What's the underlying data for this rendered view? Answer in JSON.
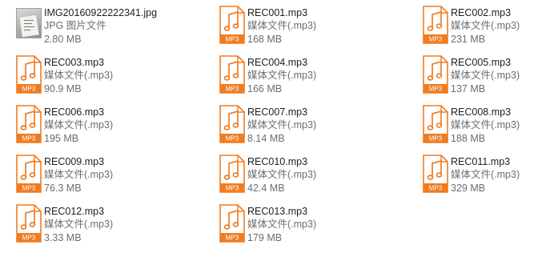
{
  "colors": {
    "mp3_accent": "#f07c22",
    "text_primary": "#1e1e1e",
    "text_secondary": "#6d6d6d"
  },
  "files": [
    {
      "name": "IMG20160922222341.jpg",
      "type": "JPG 图片文件",
      "size": "2.80 MB",
      "icon": "image-thumbnail"
    },
    {
      "name": "REC001.mp3",
      "type": "媒体文件(.mp3)",
      "size": "168 MB",
      "icon": "mp3-file-icon",
      "badge": "MP3"
    },
    {
      "name": "REC002.mp3",
      "type": "媒体文件(.mp3)",
      "size": "231 MB",
      "icon": "mp3-file-icon",
      "badge": "MP3"
    },
    {
      "name": "REC003.mp3",
      "type": "媒体文件(.mp3)",
      "size": "90.9 MB",
      "icon": "mp3-file-icon",
      "badge": "MP3"
    },
    {
      "name": "REC004.mp3",
      "type": "媒体文件(.mp3)",
      "size": "166 MB",
      "icon": "mp3-file-icon",
      "badge": "MP3"
    },
    {
      "name": "REC005.mp3",
      "type": "媒体文件(.mp3)",
      "size": "137 MB",
      "icon": "mp3-file-icon",
      "badge": "MP3"
    },
    {
      "name": "REC006.mp3",
      "type": "媒体文件(.mp3)",
      "size": "195 MB",
      "icon": "mp3-file-icon",
      "badge": "MP3"
    },
    {
      "name": "REC007.mp3",
      "type": "媒体文件(.mp3)",
      "size": "8.14 MB",
      "icon": "mp3-file-icon",
      "badge": "MP3"
    },
    {
      "name": "REC008.mp3",
      "type": "媒体文件(.mp3)",
      "size": "188 MB",
      "icon": "mp3-file-icon",
      "badge": "MP3"
    },
    {
      "name": "REC009.mp3",
      "type": "媒体文件(.mp3)",
      "size": "76.3 MB",
      "icon": "mp3-file-icon",
      "badge": "MP3"
    },
    {
      "name": "REC010.mp3",
      "type": "媒体文件(.mp3)",
      "size": "42.4 MB",
      "icon": "mp3-file-icon",
      "badge": "MP3"
    },
    {
      "name": "REC011.mp3",
      "type": "媒体文件(.mp3)",
      "size": "329 MB",
      "icon": "mp3-file-icon",
      "badge": "MP3"
    },
    {
      "name": "REC012.mp3",
      "type": "媒体文件(.mp3)",
      "size": "3.33 MB",
      "icon": "mp3-file-icon",
      "badge": "MP3"
    },
    {
      "name": "REC013.mp3",
      "type": "媒体文件(.mp3)",
      "size": "179 MB",
      "icon": "mp3-file-icon",
      "badge": "MP3"
    }
  ]
}
